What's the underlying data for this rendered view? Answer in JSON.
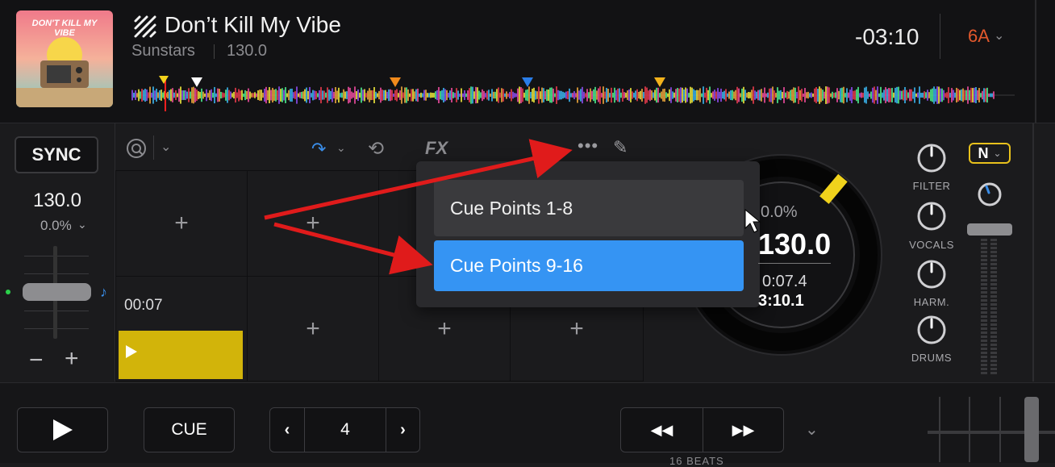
{
  "track": {
    "title": "Don’t Kill My Vibe",
    "artist": "Sunstars",
    "bpm": "130.0",
    "time_remaining": "-03:10",
    "key": "6A",
    "album_art_text": "DON'T KILL MY VIBE"
  },
  "left_panel": {
    "sync_label": "SYNC",
    "bpm": "130.0",
    "pitch": "0.0%",
    "minus_label": "−",
    "plus_label": "+"
  },
  "pads": {
    "cue_time": "00:07",
    "empty_label": "+"
  },
  "dropdown": {
    "items": [
      {
        "label": "Cue Points 1-8",
        "selected": false
      },
      {
        "label": "Cue Points 9-16",
        "selected": true
      }
    ]
  },
  "platter": {
    "pitch": "0.0%",
    "bpm": "130.0",
    "elapsed": "0:07.4",
    "remaining": "3:10.1"
  },
  "mixer": {
    "knobs": [
      "FILTER",
      "VOCALS",
      "HARM.",
      "DRUMS"
    ],
    "n_badge": "N"
  },
  "transport": {
    "cue_label": "CUE",
    "loop_value": "4",
    "beats_label": "16 BEATS"
  },
  "colors": {
    "accent_blue": "#3594f3",
    "cue_yellow": "#d2b40a",
    "key_orange": "#e2582c",
    "arrow_red": "#e01b1b"
  }
}
